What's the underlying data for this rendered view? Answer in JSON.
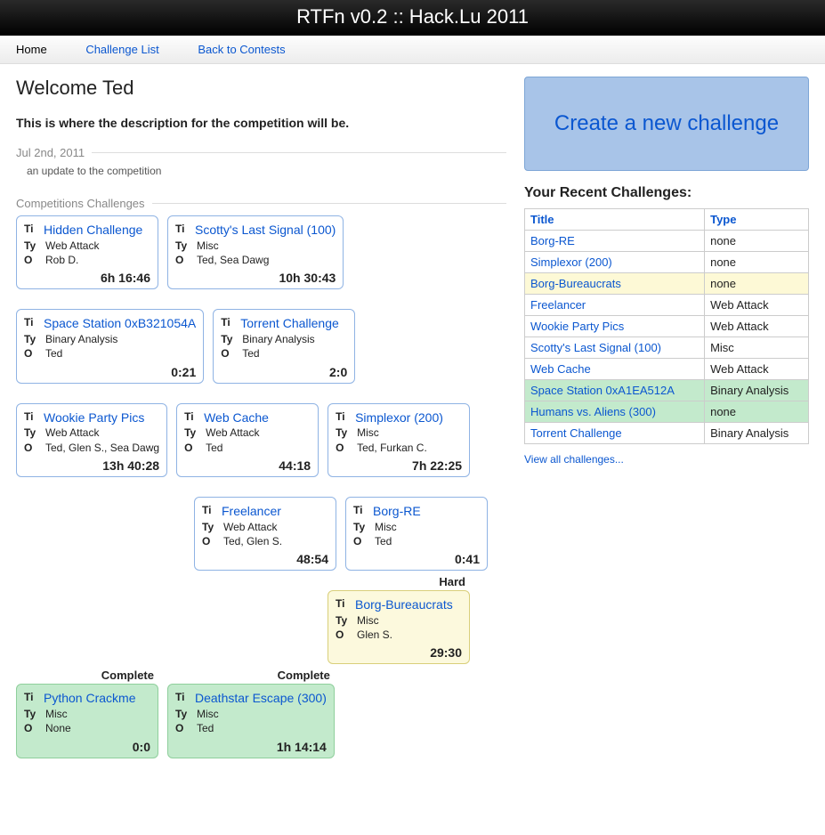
{
  "header": {
    "title": "RTFn v0.2 :: Hack.Lu 2011"
  },
  "nav": {
    "home": "Home",
    "challenge_list": "Challenge List",
    "back": "Back to Contests"
  },
  "welcome": "Welcome Ted",
  "description": "This is where the description for the competition will be.",
  "update_date": "Jul 2nd, 2011",
  "update_text": "an update to the competition",
  "competitions_label": "Competitions Challenges",
  "labels": {
    "title": "Ti",
    "type": "Ty",
    "owner": "O"
  },
  "rows": [
    [
      {
        "title": "Hidden Challenge",
        "type": "Web Attack",
        "owner": "Rob D.",
        "time": "6h 16:46",
        "style": "white"
      },
      {
        "title": "Scotty's Last Signal (100)",
        "type": "Misc",
        "owner": "Ted, Sea Dawg",
        "time": "10h 30:43",
        "style": "white"
      }
    ],
    [
      {
        "title": "Space Station 0xB321054A",
        "type": "Binary Analysis",
        "owner": "Ted",
        "time": "0:21",
        "style": "white"
      },
      {
        "title": "Torrent Challenge",
        "type": "Binary Analysis",
        "owner": "Ted",
        "time": "2:0",
        "style": "white"
      }
    ],
    [
      {
        "title": "Wookie Party Pics",
        "type": "Web Attack",
        "owner": "Ted, Glen S., Sea Dawg",
        "time": "13h 40:28",
        "style": "white"
      },
      {
        "title": "Web Cache",
        "type": "Web Attack",
        "owner": "Ted",
        "time": "44:18",
        "style": "white"
      },
      {
        "title": "Simplexor (200)",
        "type": "Misc",
        "owner": "Ted, Furkan C.",
        "time": "7h 22:25",
        "style": "white"
      }
    ],
    [
      {
        "title": "Freelancer",
        "type": "Web Attack",
        "owner": "Ted, Glen S.",
        "time": "48:54",
        "style": "white",
        "offset": true
      },
      {
        "title": "Borg-RE",
        "type": "Misc",
        "owner": "Ted",
        "time": "0:41",
        "style": "white"
      }
    ],
    [
      {
        "title": "Borg-Bureaucrats",
        "type": "Misc",
        "owner": "Glen S.",
        "time": "29:30",
        "style": "yellow",
        "badge": "Hard",
        "offset2": true
      }
    ],
    [
      {
        "title": "Python Crackme",
        "type": "Misc",
        "owner": "None",
        "time": "0:0",
        "style": "green",
        "badge": "Complete"
      },
      {
        "title": "Deathstar Escape (300)",
        "type": "Misc",
        "owner": "Ted",
        "time": "1h 14:14",
        "style": "green",
        "badge": "Complete"
      }
    ]
  ],
  "create_label": "Create a new challenge",
  "recent_header": "Your Recent Challenges:",
  "recent_cols": {
    "title": "Title",
    "type": "Type"
  },
  "recent": [
    {
      "title": "Borg-RE",
      "type": "none",
      "row": ""
    },
    {
      "title": "Simplexor (200)",
      "type": "none",
      "row": ""
    },
    {
      "title": "Borg-Bureaucrats",
      "type": "none",
      "row": "row-yellow"
    },
    {
      "title": "Freelancer",
      "type": "Web Attack",
      "row": ""
    },
    {
      "title": "Wookie Party Pics",
      "type": "Web Attack",
      "row": ""
    },
    {
      "title": "Scotty's Last Signal (100)",
      "type": "Misc",
      "row": ""
    },
    {
      "title": "Web Cache",
      "type": "Web Attack",
      "row": ""
    },
    {
      "title": "Space Station 0xA1EA512A",
      "type": "Binary Analysis",
      "row": "row-green"
    },
    {
      "title": "Humans vs. Aliens (300)",
      "type": "none",
      "row": "row-green"
    },
    {
      "title": "Torrent Challenge",
      "type": "Binary Analysis",
      "row": ""
    }
  ],
  "view_all": "View all challenges..."
}
